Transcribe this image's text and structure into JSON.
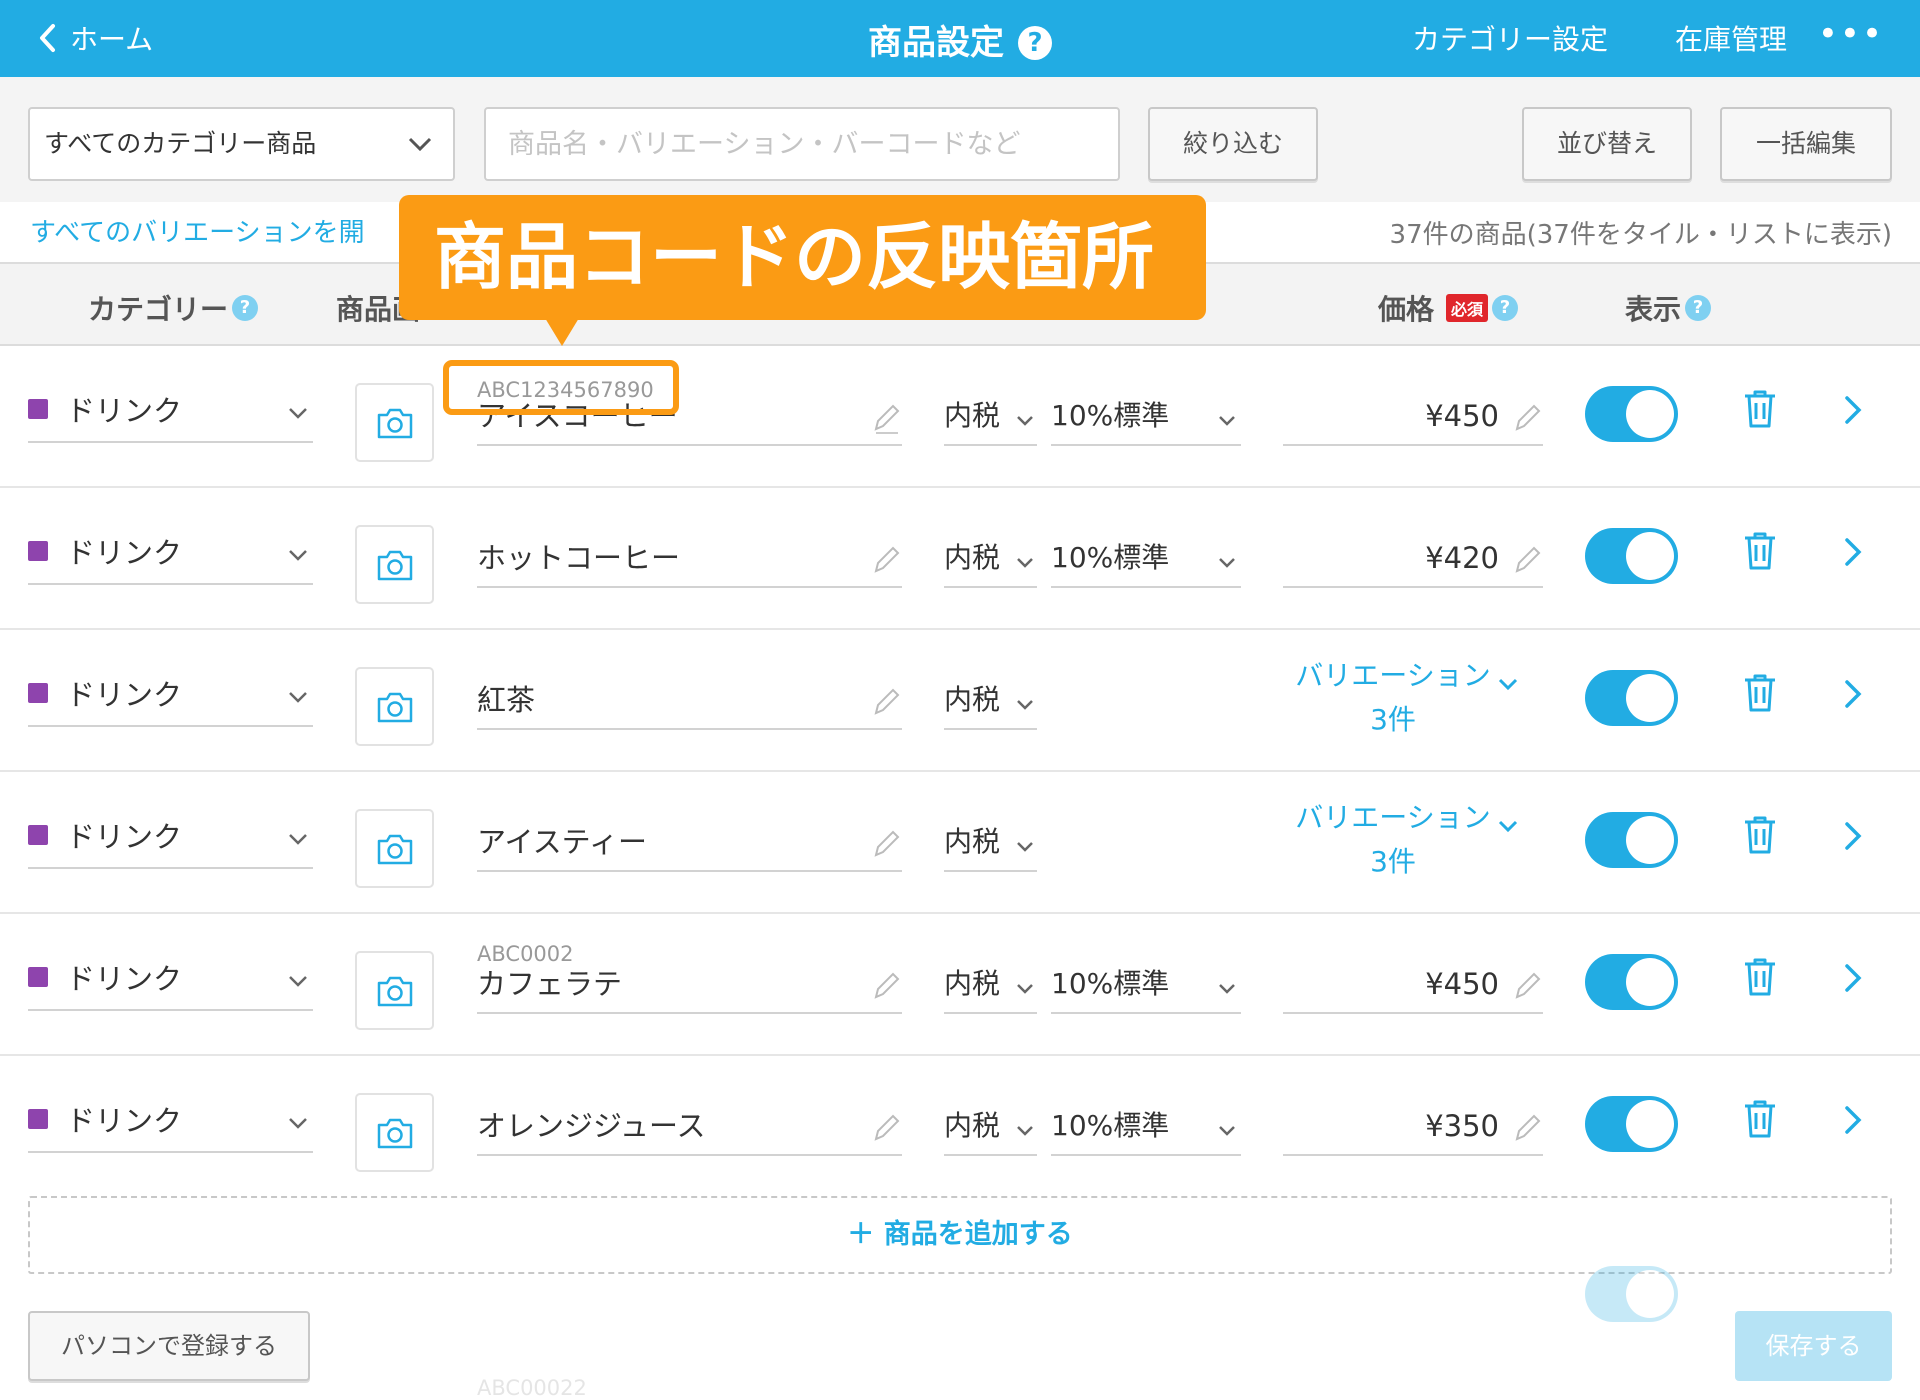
{
  "header": {
    "back_label": "ホーム",
    "title": "商品設定",
    "help_symbol": "?",
    "nav_category": "カテゴリー設定",
    "nav_inventory": "在庫管理",
    "more_symbol": "•••"
  },
  "filters": {
    "category_selected": "すべてのカテゴリー商品",
    "search_placeholder": "商品名・バリエーション・バーコードなど",
    "narrow_label": "絞り込む",
    "sort_label": "並び替え",
    "bulk_edit_label": "一括編集",
    "expand_variations_label": "すべてのバリエーションを開",
    "count_label": "37件の商品(37件をタイル・リストに表示)"
  },
  "columns": {
    "category": "カテゴリー",
    "image": "商品画",
    "price": "価格",
    "required_badge": "必須",
    "display": "表示"
  },
  "rows": [
    {
      "category": "ドリンク",
      "code": "ABC1234567890",
      "name": "アイスコーヒー",
      "tax": "内税",
      "rate": "10%標準",
      "price": "¥450",
      "enabled": true
    },
    {
      "category": "ドリンク",
      "code": "",
      "name": "ホットコーヒー",
      "tax": "内税",
      "rate": "10%標準",
      "price": "¥420",
      "enabled": true
    },
    {
      "category": "ドリンク",
      "code": "",
      "name": "紅茶",
      "tax": "内税",
      "variation_label": "バリエーション",
      "variation_count": "3件",
      "enabled": true
    },
    {
      "category": "ドリンク",
      "code": "",
      "name": "アイスティー",
      "tax": "内税",
      "variation_label": "バリエーション",
      "variation_count": "3件",
      "enabled": true
    },
    {
      "category": "ドリンク",
      "code": "ABC0002",
      "name": "カフェラテ",
      "tax": "内税",
      "rate": "10%標準",
      "price": "¥450",
      "enabled": true
    },
    {
      "category": "ドリンク",
      "code": "",
      "name": "オレンジジュース",
      "tax": "内税",
      "rate": "10%標準",
      "price": "¥350",
      "enabled": true
    }
  ],
  "ghost_row": {
    "code": "ABC00022"
  },
  "add_product_label": "＋ 商品を追加する",
  "footer": {
    "register_pc_label": "パソコンで登録する",
    "save_label": "保存する"
  },
  "annotation": {
    "callout_text": "商品コードの反映箇所"
  },
  "colors": {
    "primary": "#22ace3",
    "accent_orange": "#fb9b14",
    "category_swatch": "#8e44ad",
    "required_red": "#e0262b"
  },
  "icons": {
    "back": "chevron-left-icon",
    "help": "question-circle-icon",
    "more": "more-horizontal-icon",
    "dropdown": "chevron-down-icon",
    "camera": "camera-icon",
    "edit": "pencil-icon",
    "delete": "trash-icon",
    "detail": "chevron-right-icon"
  }
}
